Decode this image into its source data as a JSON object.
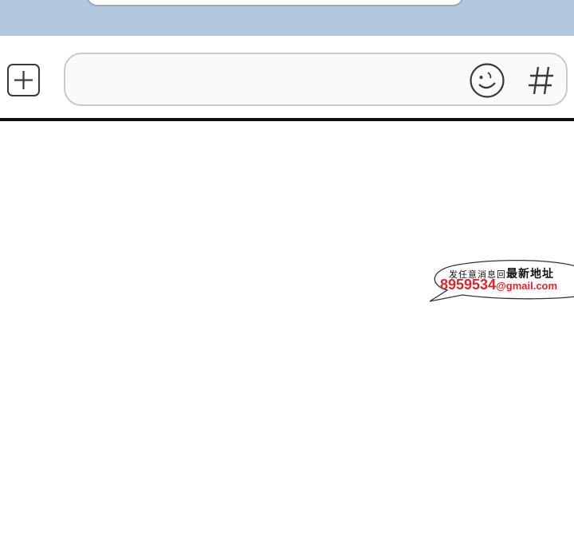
{
  "composer": {
    "add_icon": "plus-icon",
    "emoji_icon": "smiley-icon",
    "hashtag_icon": "hashtag-icon",
    "message_value": "",
    "colors": {
      "top_band": "#b1c7dd",
      "field_border": "#c9c9c9",
      "icon_stroke": "#3a3a3a",
      "divider": "#111111"
    }
  },
  "watermark": {
    "line1_small": "发任意消息回",
    "line1_big": "最新地址",
    "number": "8959534",
    "email_suffix": "@gmail.com",
    "accent_color": "#e0242b"
  }
}
